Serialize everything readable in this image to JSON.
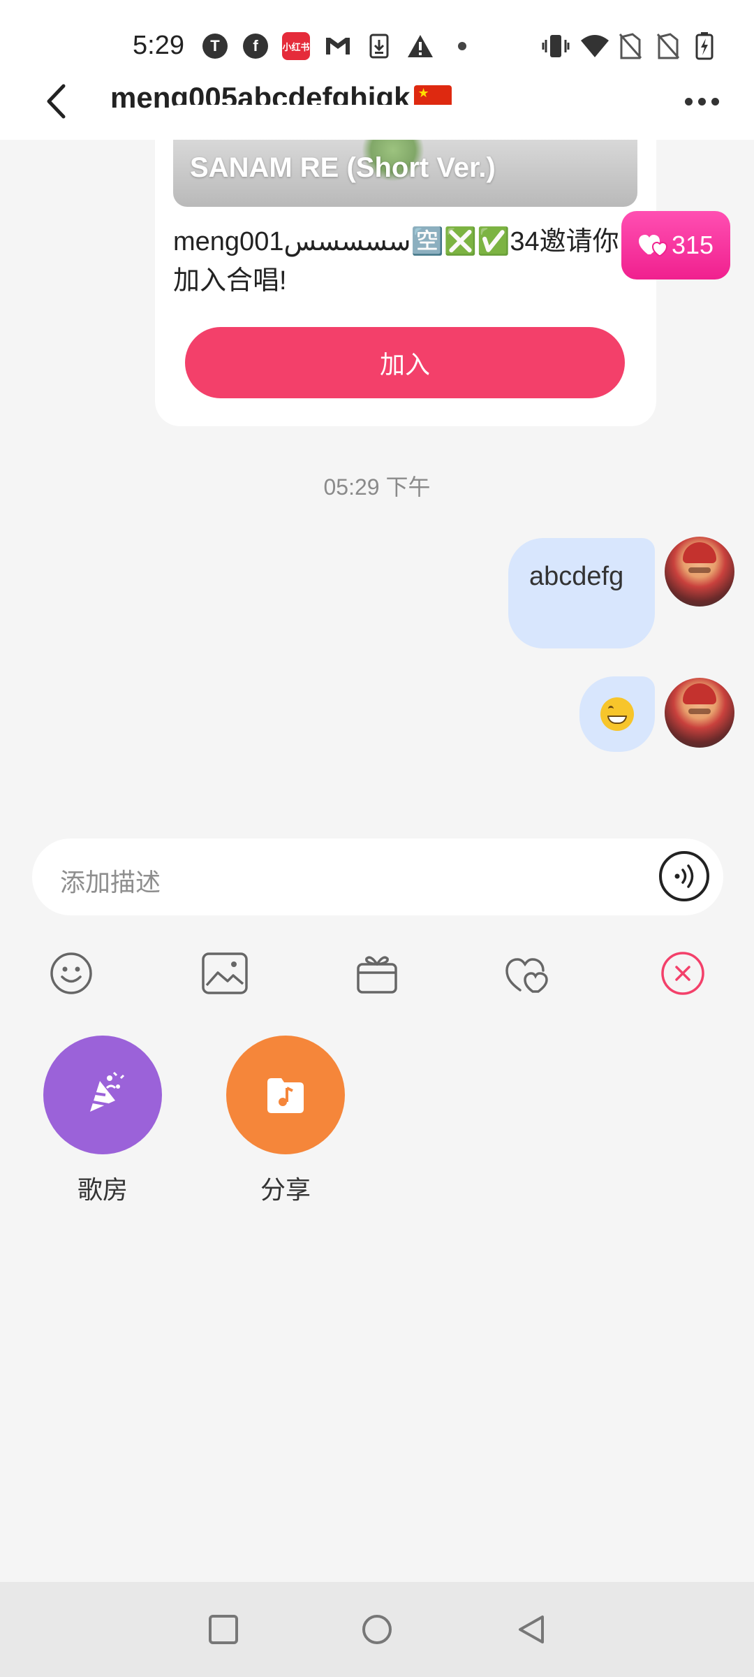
{
  "status_bar": {
    "time": "5:29",
    "notification_icons": [
      "app-icon",
      "facebook-icon",
      "xiaohongshu-icon",
      "gmail-icon",
      "download-icon",
      "warning-icon",
      "dot-icon"
    ],
    "xiaohongshu_label": "小红书",
    "system_icons": [
      "vibrate-icon",
      "wifi-icon",
      "sim-off-icon",
      "sim-off-icon",
      "battery-charging-icon"
    ]
  },
  "header": {
    "title": "meng005abcdefghigk",
    "flag": "china-flag"
  },
  "invite_card": {
    "song_title": "SANAM RE (Short Ver.)",
    "message": "meng001سسسسس🈳❎✅34邀请你加入合唱!",
    "join_label": "加入"
  },
  "likes_badge": {
    "count": "315",
    "icon": "heart-icon"
  },
  "timestamp": "05:29 下午",
  "messages": [
    {
      "type": "text",
      "text": "abcdefg",
      "sender": "me"
    },
    {
      "type": "emoji",
      "emoji": "grinning-face",
      "sender": "me"
    }
  ],
  "input": {
    "placeholder": "添加描述",
    "voice_icon": "voice-icon"
  },
  "toolbar": [
    "emoji-icon",
    "image-icon",
    "gift-icon",
    "chorus-icon",
    "close-icon"
  ],
  "colors": {
    "accent": "#f3406a",
    "likes": "#ff3fa6",
    "bubble": "#d8e6fd",
    "room": "#9b62d9",
    "share": "#f5863a"
  },
  "actions": [
    {
      "label": "歌房",
      "icon": "party-icon"
    },
    {
      "label": "分享",
      "icon": "music-file-icon"
    }
  ]
}
